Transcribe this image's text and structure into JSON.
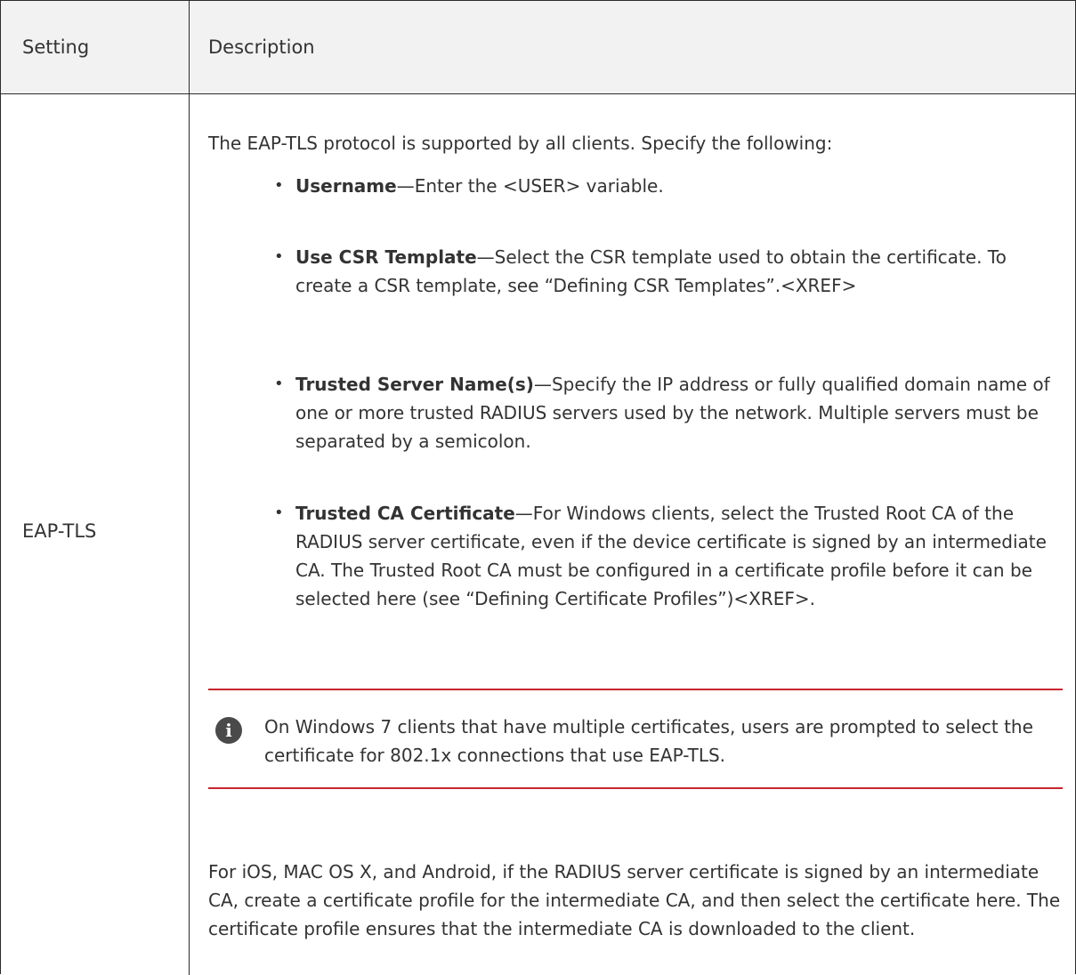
{
  "table": {
    "headers": {
      "setting": "Setting",
      "description": "Description"
    },
    "row": {
      "setting": "EAP-TLS",
      "intro": "The EAP-TLS protocol is supported by all clients. Specify the following:",
      "bullets": [
        {
          "term": "Username",
          "text": "—Enter the <USER> variable."
        },
        {
          "term": "Use CSR Template",
          "text": "—Select the CSR template used to obtain the certificate. To create a CSR template, see “Defining CSR Templates”.<XREF>"
        },
        {
          "term": "Trusted Server Name(s)",
          "text": "—Specify the IP address or fully qualified domain name of one or more trusted RADIUS servers used by the network. Multiple servers must be separated by a semicolon."
        },
        {
          "term": "Trusted CA Certificate",
          "text": "—For Windows clients, select the Trusted Root CA of the RADIUS server certificate, even if the device certificate is signed by an intermediate CA. The Trusted Root CA must be configured in a certificate profile before it can be selected here (see “Defining Certificate Profiles”)<XREF>."
        }
      ],
      "note": {
        "icon": "info-icon",
        "text": "On Windows 7 clients that have multiple certificates, users are prompted to select the certificate for 802.1x connections that use EAP-TLS."
      },
      "closing": "For iOS, MAC OS X, and Android, if the RADIUS server certificate is signed by an intermediate CA, create a certificate profile for the intermediate CA, and then select the certificate here. The certificate profile ensures that the intermediate CA is downloaded to the client."
    }
  },
  "colors": {
    "text": "#333333",
    "header_background": "#f2f2f2",
    "border": "#2b2b2b",
    "note_rule": "#c8262e",
    "note_icon": "#4a4a4a"
  }
}
